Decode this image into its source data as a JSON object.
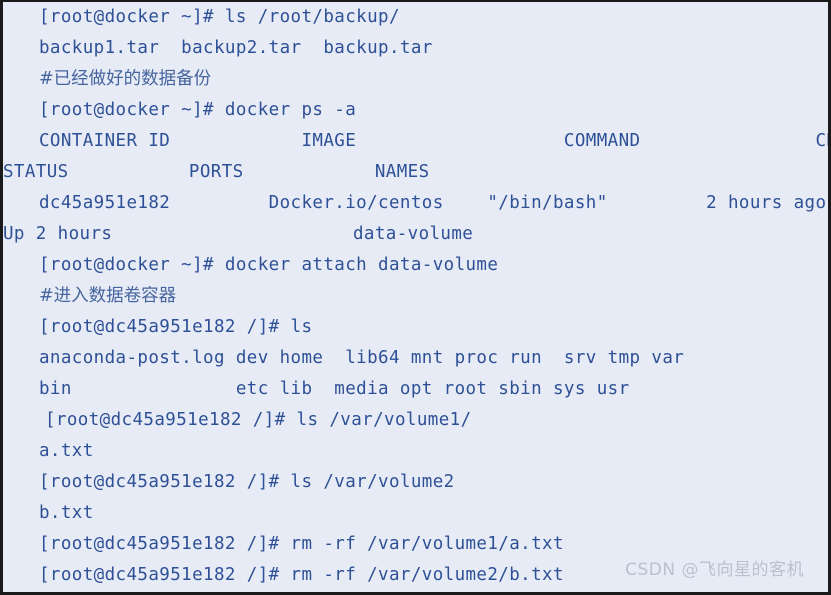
{
  "terminal": {
    "background_color": "#e7ebf5",
    "text_color": "#2e5096",
    "border_color": "#1a1a1a",
    "hostname": "docker",
    "container_id": "dc45a951e182",
    "container_name": "data-volume",
    "prompt_host": "[root@docker ~]#",
    "prompt_container": "[root@dc45a951e182 /]#",
    "lines": [
      {
        "indent": 1,
        "cjk": false,
        "text": "[root@docker ~]# ls /root/backup/"
      },
      {
        "indent": 1,
        "cjk": false,
        "text": "backup1.tar  backup2.tar  backup.tar"
      },
      {
        "indent": 1,
        "cjk": true,
        "text": "#已经做好的数据备份"
      },
      {
        "indent": 1,
        "cjk": false,
        "text": "[root@docker ~]# docker ps -a"
      },
      {
        "indent": 1,
        "cjk": false,
        "text": "CONTAINER ID            IMAGE                   COMMAND                CREATED"
      },
      {
        "indent": 0,
        "cjk": false,
        "text": "STATUS           PORTS            NAMES"
      },
      {
        "indent": 1,
        "cjk": false,
        "text": "dc45a951e182         Docker.io/centos    \"/bin/bash\"         2 hours ago"
      },
      {
        "indent": 0,
        "cjk": false,
        "text": "Up 2 hours                      data-volume"
      },
      {
        "indent": 1,
        "cjk": false,
        "text": "[root@docker ~]# docker attach data-volume"
      },
      {
        "indent": 1,
        "cjk": true,
        "text": "#进入数据卷容器"
      },
      {
        "indent": 1,
        "cjk": false,
        "text": "[root@dc45a951e182 /]# ls"
      },
      {
        "indent": 1,
        "cjk": false,
        "text": "anaconda-post.log dev home  lib64 mnt proc run  srv tmp var"
      },
      {
        "indent": 1,
        "cjk": false,
        "text": "bin               etc lib  media opt root sbin sys usr"
      },
      {
        "indent": 2,
        "cjk": false,
        "text": "[root@dc45a951e182 /]# ls /var/volume1/"
      },
      {
        "indent": 1,
        "cjk": false,
        "text": "a.txt"
      },
      {
        "indent": 1,
        "cjk": false,
        "text": "[root@dc45a951e182 /]# ls /var/volume2"
      },
      {
        "indent": 1,
        "cjk": false,
        "text": "b.txt"
      },
      {
        "indent": 1,
        "cjk": false,
        "text": "[root@dc45a951e182 /]# rm -rf /var/volume1/a.txt"
      },
      {
        "indent": 1,
        "cjk": false,
        "text": "[root@dc45a951e182 /]# rm -rf /var/volume2/b.txt"
      }
    ],
    "docker_ps_table": {
      "headers": [
        "CONTAINER ID",
        "IMAGE",
        "COMMAND",
        "CREATED",
        "STATUS",
        "PORTS",
        "NAMES"
      ],
      "rows": [
        {
          "CONTAINER ID": "dc45a951e182",
          "IMAGE": "Docker.io/centos",
          "COMMAND": "\"/bin/bash\"",
          "CREATED": "2 hours ago",
          "STATUS": "Up 2 hours",
          "PORTS": "",
          "NAMES": "data-volume"
        }
      ]
    },
    "backup_files": [
      "backup1.tar",
      "backup2.tar",
      "backup.tar"
    ],
    "root_listing": [
      "anaconda-post.log",
      "dev",
      "home",
      "lib64",
      "mnt",
      "proc",
      "run",
      "srv",
      "tmp",
      "var",
      "bin",
      "etc",
      "lib",
      "media",
      "opt",
      "root",
      "sbin",
      "sys",
      "usr"
    ],
    "volume1_listing": [
      "a.txt"
    ],
    "volume2_listing": [
      "b.txt"
    ]
  },
  "watermark": {
    "text": "CSDN @飞向星的客机",
    "color": "#b9c0cf"
  }
}
